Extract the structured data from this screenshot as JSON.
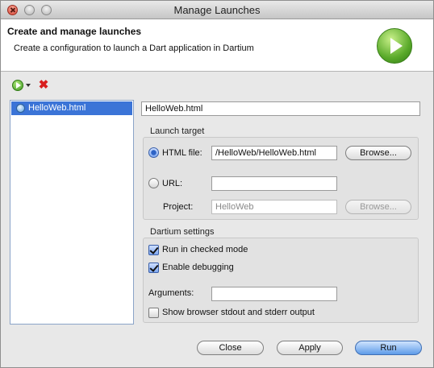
{
  "window": {
    "title": "Manage Launches"
  },
  "header": {
    "title": "Create and manage launches",
    "subtitle": "Create a configuration to launch a Dart application in Dartium",
    "icon": "run-icon"
  },
  "toolbar": {
    "run_icon": "run-icon",
    "delete_icon": "delete-icon",
    "delete_glyph": "✖"
  },
  "launches": {
    "items": [
      {
        "label": "HelloWeb.html",
        "icon": "dart-file-icon",
        "selected": true
      }
    ]
  },
  "config": {
    "name": "HelloWeb.html",
    "launch_target": {
      "label": "Launch target",
      "html_file_label": "HTML file:",
      "html_file_value": "/HelloWeb/HelloWeb.html",
      "browse_label": "Browse...",
      "url_label": "URL:",
      "url_value": "",
      "project_label": "Project:",
      "project_value": "HelloWeb",
      "project_browse_label": "Browse..."
    },
    "dartium": {
      "label": "Dartium settings",
      "checked_mode_label": "Run in checked mode",
      "checked_mode": true,
      "debugging_label": "Enable debugging",
      "debugging": true,
      "arguments_label": "Arguments:",
      "arguments_value": "",
      "stdout_label": "Show browser stdout and stderr output",
      "stdout": false
    }
  },
  "buttons": {
    "close": "Close",
    "apply": "Apply",
    "run": "Run"
  }
}
